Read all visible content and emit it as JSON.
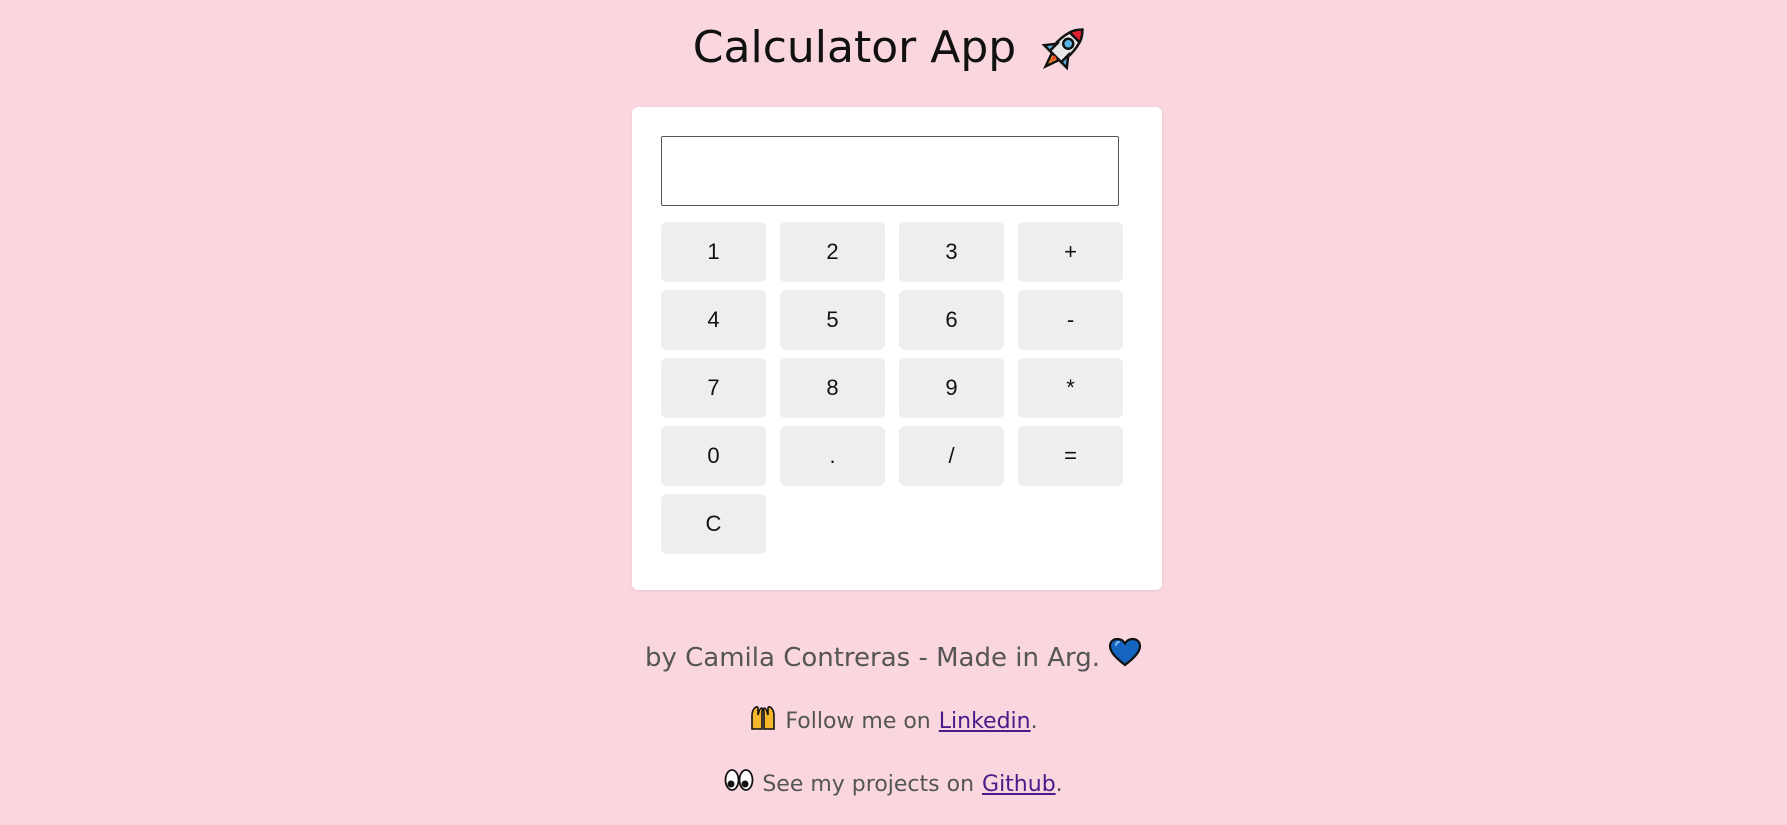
{
  "header": {
    "title": "Calculator App",
    "title_icon": "rocket-icon"
  },
  "calculator": {
    "display_value": "",
    "keys": [
      {
        "label": "1",
        "name": "key-1"
      },
      {
        "label": "2",
        "name": "key-2"
      },
      {
        "label": "3",
        "name": "key-3"
      },
      {
        "label": "+",
        "name": "key-plus"
      },
      {
        "label": "4",
        "name": "key-4"
      },
      {
        "label": "5",
        "name": "key-5"
      },
      {
        "label": "6",
        "name": "key-6"
      },
      {
        "label": "-",
        "name": "key-minus"
      },
      {
        "label": "7",
        "name": "key-7"
      },
      {
        "label": "8",
        "name": "key-8"
      },
      {
        "label": "9",
        "name": "key-9"
      },
      {
        "label": "*",
        "name": "key-multiply"
      },
      {
        "label": "0",
        "name": "key-0"
      },
      {
        "label": ".",
        "name": "key-decimal"
      },
      {
        "label": "/",
        "name": "key-divide"
      },
      {
        "label": "=",
        "name": "key-equals"
      },
      {
        "label": "C",
        "name": "key-clear"
      }
    ]
  },
  "footer": {
    "credit": "by Camila Contreras - Made in Arg.",
    "credit_icon": "blue-heart-icon",
    "follow_prefix": "Follow me on",
    "follow_link": "Linkedin",
    "follow_suffix": ".",
    "follow_icon": "raised-hands-icon",
    "projects_prefix": "See my projects on",
    "projects_link": "Github",
    "projects_suffix": ".",
    "projects_icon": "eyes-icon"
  },
  "colors": {
    "background": "#fad7de",
    "card": "#ffffff",
    "key": "#eeeeee",
    "link": "#4b1b8a",
    "heart": "#1565c0"
  }
}
